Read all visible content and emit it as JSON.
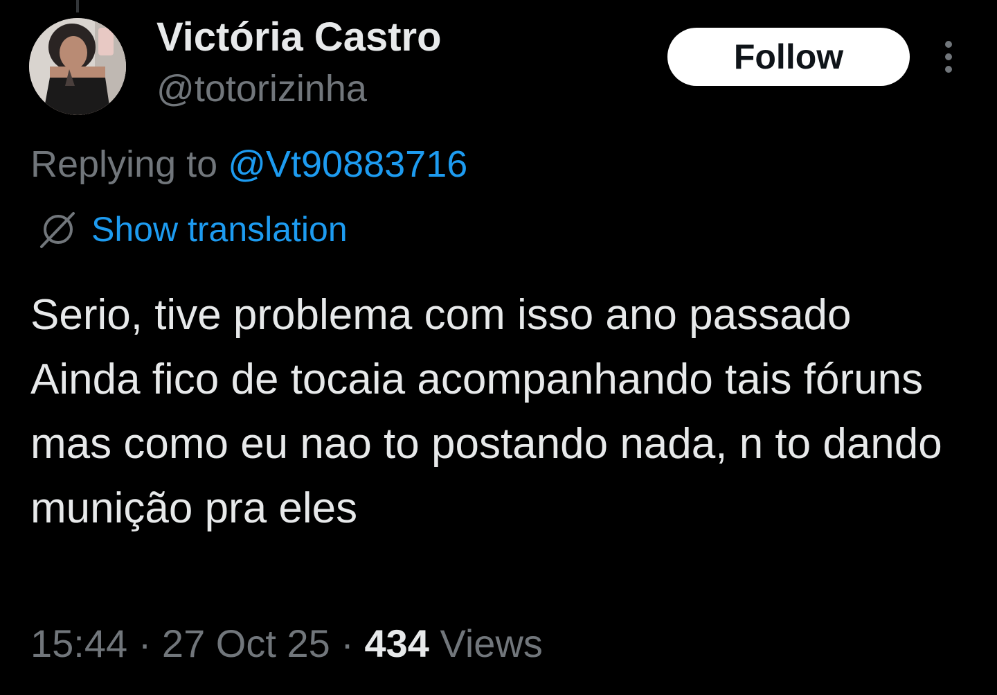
{
  "author": {
    "display_name": "Victória Castro",
    "handle": "@totorizinha",
    "avatar_icon": "profile-photo"
  },
  "actions": {
    "follow_label": "Follow",
    "more_icon": "more-vertical-icon"
  },
  "reply": {
    "prefix": "Replying to",
    "mention": "@Vt90883716"
  },
  "translation": {
    "icon": "globe-icon",
    "label": "Show translation"
  },
  "tweet": {
    "text": "Serio, tive problema com isso ano passado\nAinda fico de tocaia acompanhando tais fóruns mas como eu nao to postando nada, n to dando munição pra eles"
  },
  "meta": {
    "time": "15:44",
    "separator": "·",
    "date": "27 Oct 25",
    "views_count": "434",
    "views_label": "Views"
  },
  "colors": {
    "background": "#000000",
    "text_primary": "#e7e9ea",
    "text_secondary": "#71767b",
    "accent": "#1d9bf0",
    "button_bg": "#ffffff"
  }
}
